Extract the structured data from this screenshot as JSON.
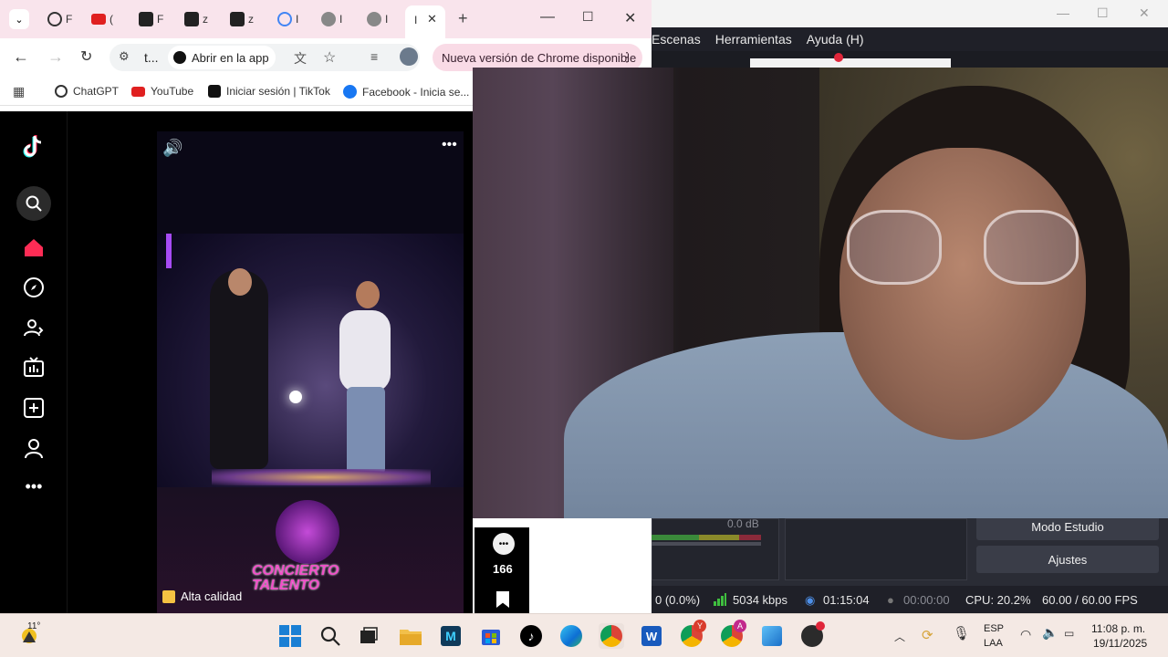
{
  "obs": {
    "menu": [
      "Escenas",
      "Herramientas",
      "Ayuda (H)"
    ],
    "db_label": "0.0 dB",
    "buttons": {
      "studio_mode": "Modo Estudio",
      "settings": "Ajustes"
    },
    "status": {
      "dropped": "0 (0.0%)",
      "bitrate": "5034 kbps",
      "stream_time": "01:15:04",
      "rec_time": "00:00:00",
      "cpu": "CPU: 20.2%",
      "fps": "60.00 / 60.00 FPS"
    }
  },
  "chrome": {
    "tabs": [
      "F",
      "(",
      "F",
      "z",
      "z",
      "I",
      "I",
      "I"
    ],
    "active_tab_label": "I",
    "new_tab": "+",
    "url_short": "t...",
    "open_in_app": "Abrir en la app",
    "update_banner": "Nueva versión de Chrome disponible",
    "bookmarks": [
      {
        "label": "ChatGPT",
        "icon": "chatgpt-icon"
      },
      {
        "label": "YouTube",
        "icon": "youtube-icon"
      },
      {
        "label": "Iniciar sesión | TikTok",
        "icon": "tiktok-icon"
      },
      {
        "label": "Facebook - Inicia se...",
        "icon": "facebook-icon"
      }
    ]
  },
  "tiktok": {
    "comment_count": "166",
    "quality_badge": "Alta calidad",
    "video_logo_text": "CONCIERTO TALENTO"
  },
  "taskbar": {
    "weather_temp": "11°",
    "lang_top": "ESP",
    "lang_bottom": "LAA",
    "time": "11:08 p. m.",
    "date": "19/11/2025",
    "badges": {
      "chrome1": "Y",
      "chrome2": "A"
    }
  }
}
